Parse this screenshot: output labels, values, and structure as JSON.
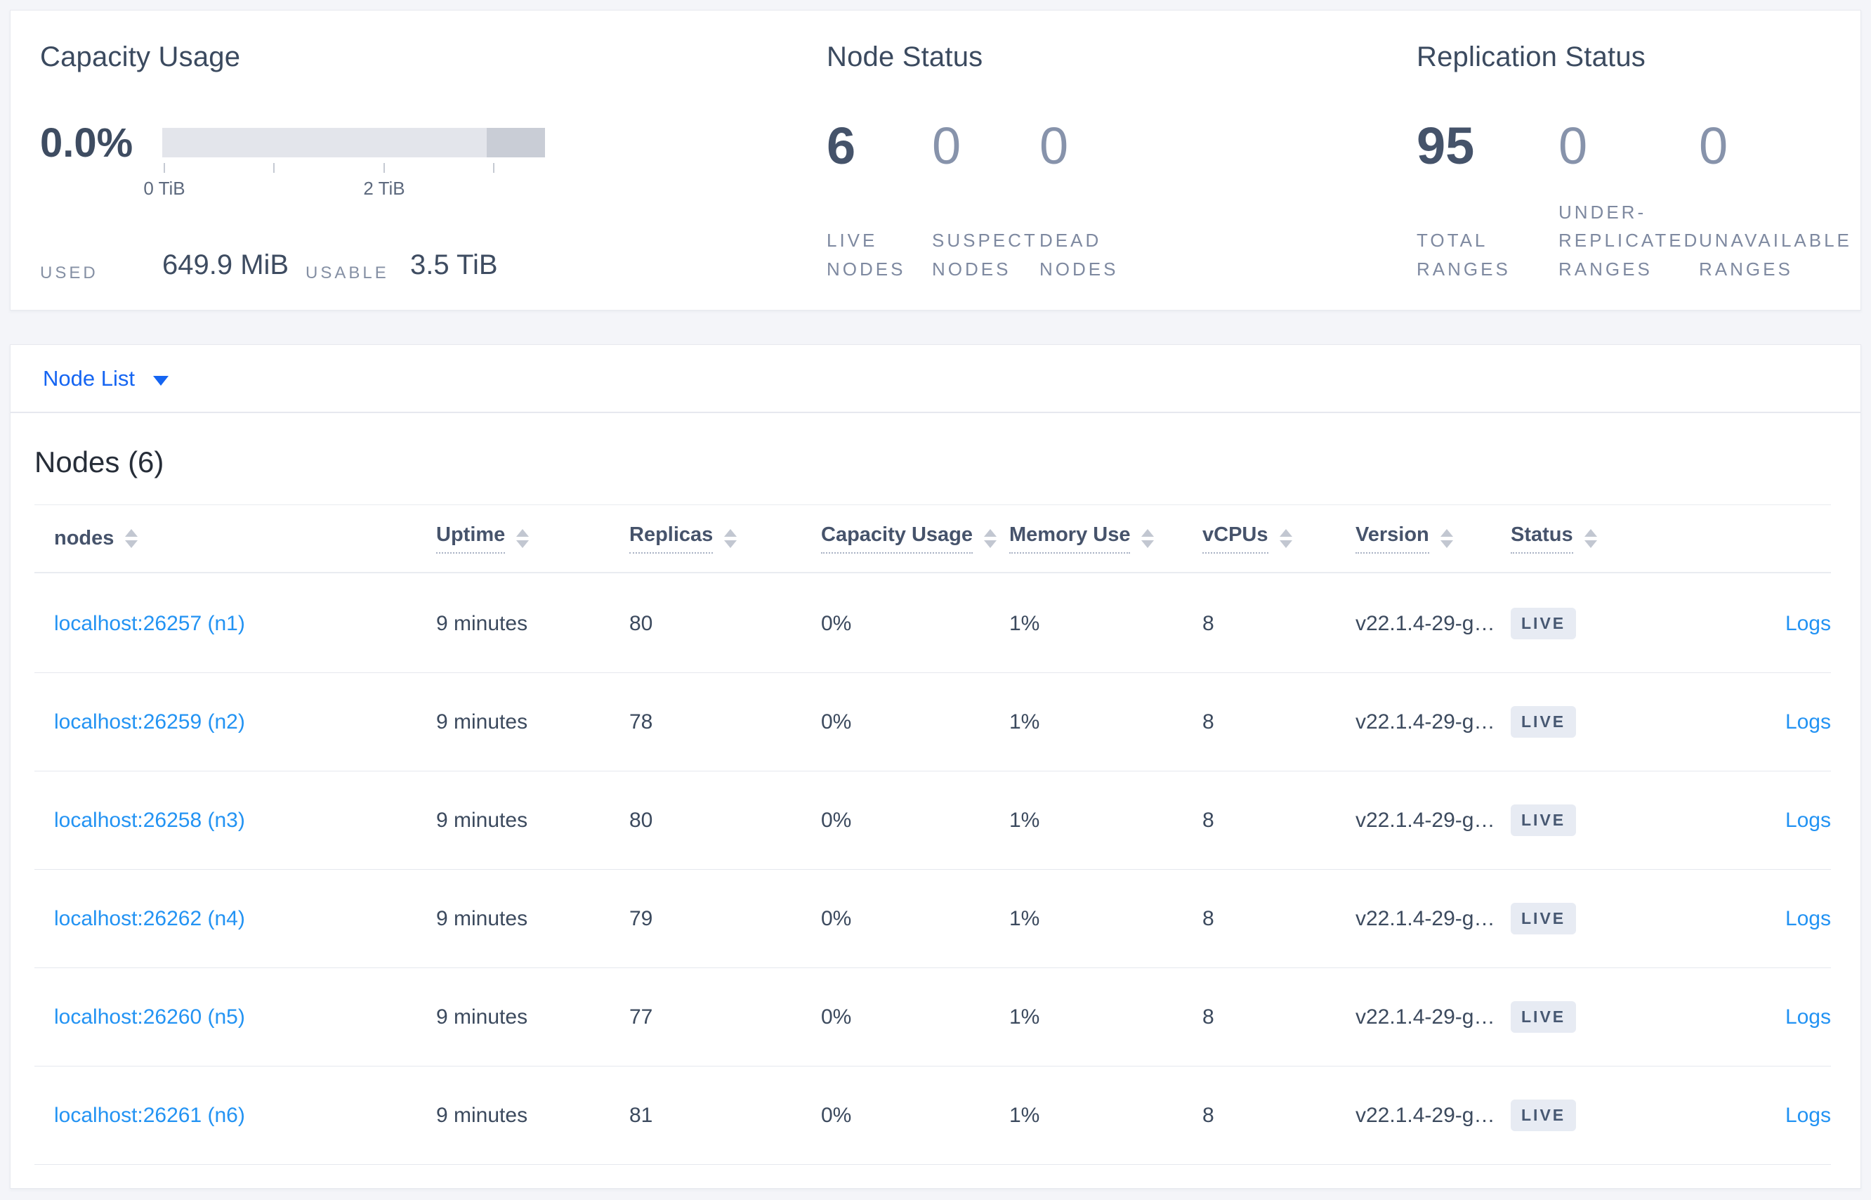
{
  "summary": {
    "capacity": {
      "title": "Capacity Usage",
      "percent": "0.0%",
      "axis_ticks": [
        "0 TiB",
        "2 TiB"
      ],
      "used_label": "USED",
      "used_value": "649.9 MiB",
      "usable_label": "USABLE",
      "usable_value": "3.5 TiB"
    },
    "node_status": {
      "title": "Node Status",
      "stats": [
        {
          "value": "6",
          "label": "LIVE\nNODES"
        },
        {
          "value": "0",
          "label": "SUSPECT\nNODES"
        },
        {
          "value": "0",
          "label": "DEAD\nNODES"
        }
      ]
    },
    "replication": {
      "title": "Replication Status",
      "stats": [
        {
          "value": "95",
          "label": "TOTAL\nRANGES"
        },
        {
          "value": "0",
          "label": "UNDER-\nREPLICATED\nRANGES"
        },
        {
          "value": "0",
          "label": "UNAVAILABLE\nRANGES"
        }
      ]
    }
  },
  "node_list_dropdown": {
    "label": "Node List"
  },
  "nodes_table": {
    "title": "Nodes (6)",
    "columns": [
      "nodes",
      "Uptime",
      "Replicas",
      "Capacity Usage",
      "Memory Use",
      "vCPUs",
      "Version",
      "Status"
    ],
    "rows": [
      {
        "address": "localhost:26257 (n1)",
        "uptime": "9 minutes",
        "replicas": "80",
        "capacity": "0%",
        "memory": "1%",
        "vcpus": "8",
        "version": "v22.1.4-29-g…",
        "status": "LIVE",
        "logs": "Logs"
      },
      {
        "address": "localhost:26259 (n2)",
        "uptime": "9 minutes",
        "replicas": "78",
        "capacity": "0%",
        "memory": "1%",
        "vcpus": "8",
        "version": "v22.1.4-29-g…",
        "status": "LIVE",
        "logs": "Logs"
      },
      {
        "address": "localhost:26258 (n3)",
        "uptime": "9 minutes",
        "replicas": "80",
        "capacity": "0%",
        "memory": "1%",
        "vcpus": "8",
        "version": "v22.1.4-29-g…",
        "status": "LIVE",
        "logs": "Logs"
      },
      {
        "address": "localhost:26262 (n4)",
        "uptime": "9 minutes",
        "replicas": "79",
        "capacity": "0%",
        "memory": "1%",
        "vcpus": "8",
        "version": "v22.1.4-29-g…",
        "status": "LIVE",
        "logs": "Logs"
      },
      {
        "address": "localhost:26260 (n5)",
        "uptime": "9 minutes",
        "replicas": "77",
        "capacity": "0%",
        "memory": "1%",
        "vcpus": "8",
        "version": "v22.1.4-29-g…",
        "status": "LIVE",
        "logs": "Logs"
      },
      {
        "address": "localhost:26261 (n6)",
        "uptime": "9 minutes",
        "replicas": "81",
        "capacity": "0%",
        "memory": "1%",
        "vcpus": "8",
        "version": "v22.1.4-29-g…",
        "status": "LIVE",
        "logs": "Logs"
      }
    ]
  },
  "colors": {
    "page_background": "#f4f5f9",
    "card_background": "#ffffff",
    "primary_text": "#394455",
    "muted_text": "#7e89a0",
    "accent_blue": "#1565f2",
    "link_blue": "#2393f3",
    "badge_background": "#e7ebf3",
    "badge_text": "#475872",
    "bar_light": "#e3e5eb",
    "bar_dark": "#c9cdd6"
  }
}
